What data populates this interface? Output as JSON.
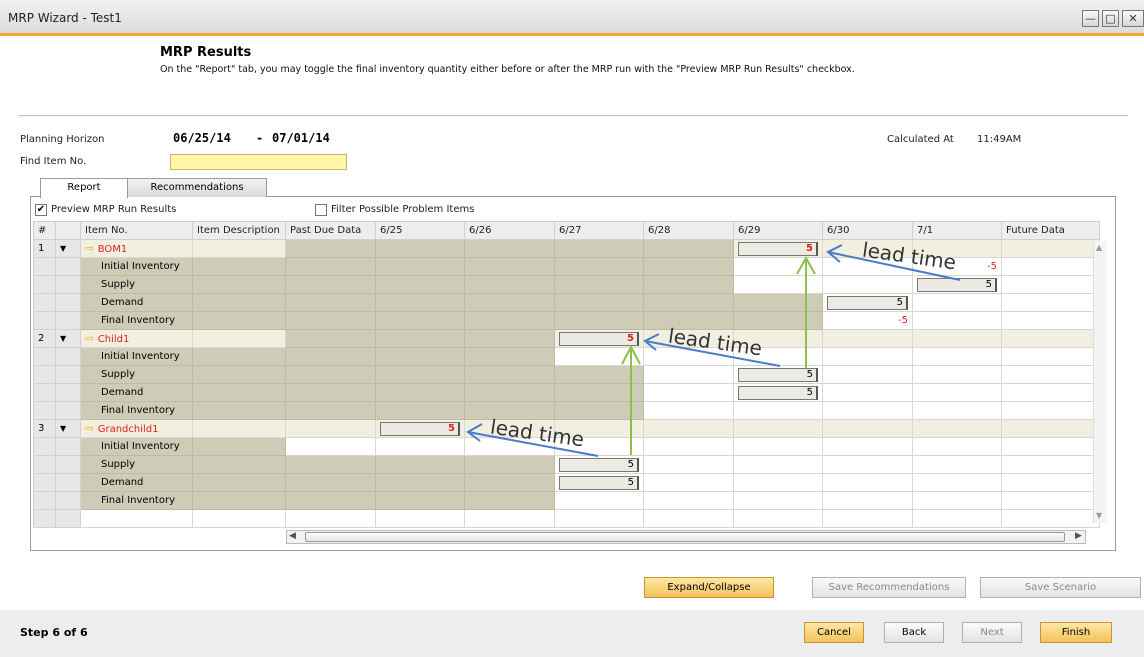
{
  "window": {
    "title": "MRP Wizard - Test1"
  },
  "header": {
    "title": "MRP Results",
    "description": "On the \"Report\" tab, you may toggle the final inventory quantity either before or after the MRP run with the \"Preview MRP Run Results\" checkbox."
  },
  "planning": {
    "label": "Planning Horizon",
    "from": "06/25/14",
    "dash": "-",
    "to": "07/01/14",
    "calculated_label": "Calculated At",
    "calculated_value": "11:49AM",
    "find_label": "Find Item No.",
    "find_value": ""
  },
  "tabs": [
    {
      "label": "Report",
      "active": true
    },
    {
      "label": "Recommendations",
      "active": false
    }
  ],
  "options": {
    "preview_label": "Preview MRP Run Results",
    "preview_checked": true,
    "filter_label": "Filter Possible Problem Items",
    "filter_checked": false
  },
  "grid": {
    "columns": [
      "#",
      "",
      "Item No.",
      "Item Description",
      "Past Due Data",
      "6/25",
      "6/26",
      "6/27",
      "6/28",
      "6/29",
      "6/30",
      "7/1",
      "Future Data"
    ],
    "rows": [
      {
        "num": "1",
        "item": "BOM1",
        "type": "item",
        "cells": [
          "",
          "",
          "",
          "",
          "",
          "5",
          "",
          "",
          ""
        ]
      },
      {
        "num": "",
        "item": "Initial Inventory",
        "type": "sub",
        "cells": [
          "",
          "",
          "",
          "",
          "",
          "",
          "",
          "-5",
          ""
        ]
      },
      {
        "num": "",
        "item": "Supply",
        "type": "sub",
        "cells": [
          "",
          "",
          "",
          "",
          "",
          "",
          "",
          "5",
          ""
        ]
      },
      {
        "num": "",
        "item": "Demand",
        "type": "sub",
        "cells": [
          "",
          "",
          "",
          "",
          "",
          "",
          "5",
          "",
          ""
        ]
      },
      {
        "num": "",
        "item": "Final Inventory",
        "type": "sub",
        "cells": [
          "",
          "",
          "",
          "",
          "",
          "",
          "-5",
          "",
          ""
        ]
      },
      {
        "num": "2",
        "item": "Child1",
        "type": "item",
        "cells": [
          "",
          "",
          "",
          "5",
          "",
          "",
          "",
          "",
          ""
        ]
      },
      {
        "num": "",
        "item": "Initial Inventory",
        "type": "sub",
        "cells": [
          "",
          "",
          "",
          "",
          "",
          "",
          "",
          "",
          ""
        ]
      },
      {
        "num": "",
        "item": "Supply",
        "type": "sub",
        "cells": [
          "",
          "",
          "",
          "",
          "",
          "5",
          "",
          "",
          ""
        ]
      },
      {
        "num": "",
        "item": "Demand",
        "type": "sub",
        "cells": [
          "",
          "",
          "",
          "",
          "",
          "5",
          "",
          "",
          ""
        ]
      },
      {
        "num": "",
        "item": "Final Inventory",
        "type": "sub",
        "cells": [
          "",
          "",
          "",
          "",
          "",
          "",
          "",
          "",
          ""
        ]
      },
      {
        "num": "3",
        "item": "Grandchild1",
        "type": "item",
        "cells": [
          "",
          "5",
          "",
          "",
          "",
          "",
          "",
          "",
          ""
        ]
      },
      {
        "num": "",
        "item": "Initial Inventory",
        "type": "sub",
        "cells": [
          "",
          "",
          "",
          "",
          "",
          "",
          "",
          "",
          ""
        ]
      },
      {
        "num": "",
        "item": "Supply",
        "type": "sub",
        "cells": [
          "",
          "",
          "",
          "5",
          "",
          "",
          "",
          "",
          ""
        ]
      },
      {
        "num": "",
        "item": "Demand",
        "type": "sub",
        "cells": [
          "",
          "",
          "",
          "5",
          "",
          "",
          "",
          "",
          ""
        ]
      },
      {
        "num": "",
        "item": "Final Inventory",
        "type": "sub",
        "cells": [
          "",
          "",
          "",
          "",
          "",
          "",
          "",
          "",
          ""
        ]
      }
    ]
  },
  "annotations": [
    "lead time",
    "lead time",
    "lead time"
  ],
  "colors": {
    "accent": "#f0a830",
    "arrow_blue": "#4a7cc8",
    "arrow_green": "#8cc04a",
    "negative": "#e02020"
  },
  "buttons": {
    "expand": "Expand/Collapse",
    "save_rec": "Save Recommendations",
    "save_scenario": "Save Scenario",
    "cancel": "Cancel",
    "back": "Back",
    "next": "Next",
    "finish": "Finish"
  },
  "footer": {
    "step": "Step 6 of 6"
  }
}
